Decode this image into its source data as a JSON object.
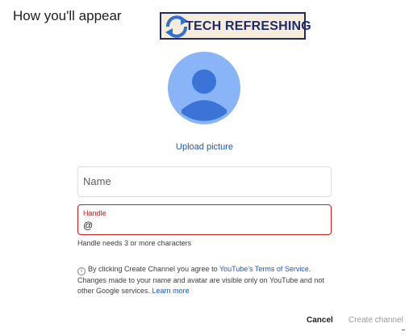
{
  "header": {
    "title": "How you'll appear"
  },
  "watermark": {
    "text": "TECH REFRESHING",
    "icon": "refresh-arrows-icon",
    "colors": {
      "text": "#1f2a6e",
      "background": "#f6ecdc",
      "arrow": "#2f6fd6"
    }
  },
  "avatar": {
    "icon": "person-avatar-icon",
    "colors": {
      "background": "#8ab4f8",
      "figure": "#3b73d6"
    }
  },
  "upload": {
    "label": "Upload picture"
  },
  "form": {
    "name": {
      "placeholder": "Name",
      "value": ""
    },
    "handle": {
      "label": "Handle",
      "value": "@",
      "error": "Handle needs 3 or more characters"
    }
  },
  "info": {
    "icon": "info-icon",
    "text_before": "By clicking Create Channel you agree to ",
    "tos_link": "YouTube's Terms of Service",
    "text_after": ". Changes made to your name and avatar are visible only on YouTube and not other Google services. ",
    "learn_more": "Learn more"
  },
  "actions": {
    "cancel_label": "Cancel",
    "create_label": "Create channel"
  },
  "colors": {
    "accent": "#1a57c9",
    "error": "#c5221f",
    "disabled": "#9a9a9a"
  }
}
